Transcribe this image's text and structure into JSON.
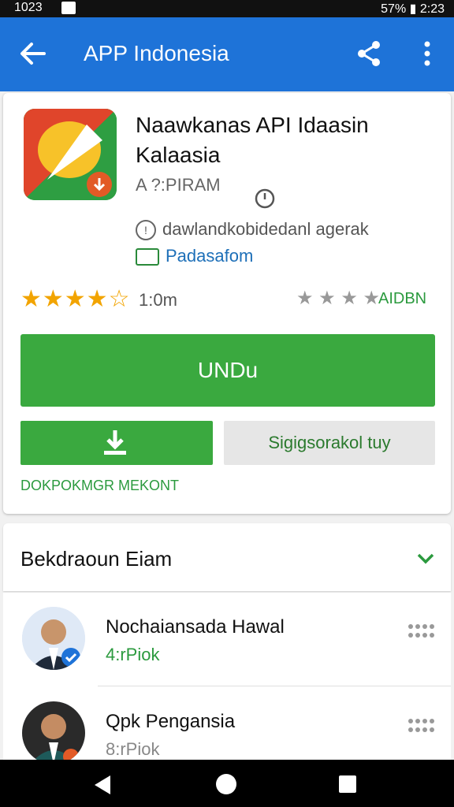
{
  "status_bar": {
    "time_left": "1023",
    "status_right": "57% ▮ 2:23"
  },
  "app_bar": {
    "title": "APP Indonesia"
  },
  "app": {
    "title": "Naawkanas API Idaasin Kalaasia",
    "developer": "A ?:PIRAM",
    "info": "dawlandkobidedanl agerak",
    "platform": "Padasafom",
    "stars_text": "★★★★☆",
    "rating_count": "1:0m",
    "right_rating_text": "★ ★ ★ ★",
    "right_rating_label": "AIDBN",
    "install_label": "UNDu",
    "secondary_button_label": "Sigigsorаkol tuy",
    "link_text": "DOKPOKMGR MEKONT"
  },
  "section": {
    "title": "Bekdraoun Eiam"
  },
  "list": {
    "items": [
      {
        "name": "Nochaiansada Hawal",
        "meta": "4:rPiok"
      },
      {
        "name": "Qpk Pengansia",
        "meta": "8:rPiok"
      }
    ]
  },
  "colors": {
    "app_bar": "#1e73d8",
    "primary": "#3aa93f",
    "accent_green": "#2b9a3e",
    "star": "#f2a400"
  }
}
